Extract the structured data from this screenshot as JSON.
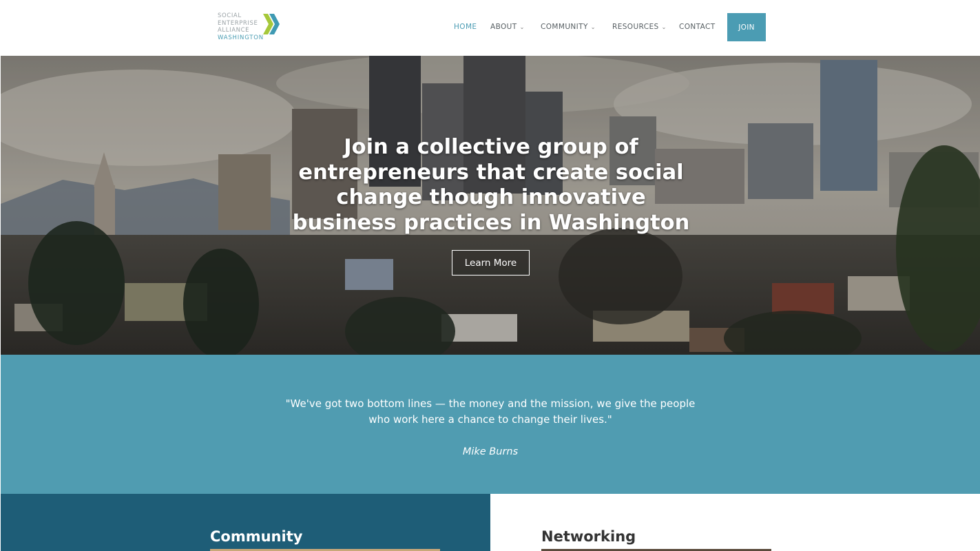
{
  "header": {
    "logo": {
      "lines": [
        "SOCIAL",
        "ENTERPRISE",
        "ALLIANCE",
        "WASHINGTON"
      ]
    },
    "nav": [
      {
        "label": "HOME",
        "active": true,
        "has_dropdown": false
      },
      {
        "label": "ABOUT",
        "active": false,
        "has_dropdown": true
      },
      {
        "label": "COMMUNITY",
        "active": false,
        "has_dropdown": true
      },
      {
        "label": "RESOURCES",
        "active": false,
        "has_dropdown": true
      },
      {
        "label": "CONTACT",
        "active": false,
        "has_dropdown": false
      }
    ],
    "join_label": "JOIN",
    "caret_icon": "chevron-down-icon"
  },
  "hero": {
    "title": "Join a collective group of entrepreneurs that create social change though innovative business practices in Washington",
    "button_label": "Learn More"
  },
  "quote": {
    "text": "\"We've got two bottom lines — the money and the mission, we give the people who work here a chance to change their lives.\"",
    "author": "Mike Burns"
  },
  "sections": {
    "community": {
      "title": "Community"
    },
    "networking": {
      "title": "Networking"
    }
  },
  "colors": {
    "accent": "#4b9cb3",
    "quote_band": "#509cb1",
    "community_panel": "#1e5d77",
    "logo_chevron_green": "#a6c83a",
    "logo_chevron_teal": "#3f9ab3"
  }
}
